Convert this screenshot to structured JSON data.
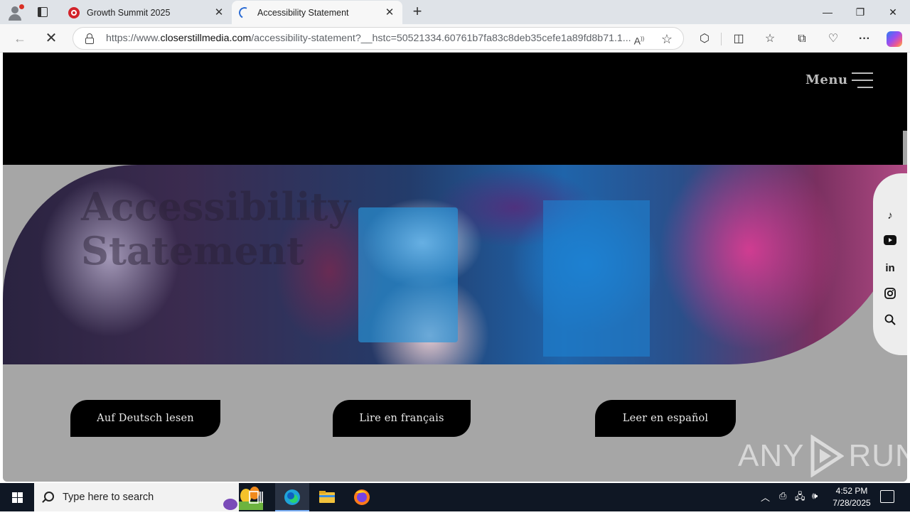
{
  "browser": {
    "tabs": [
      {
        "title": "Growth Summit 2025",
        "favicon": "red-circle-icon",
        "active": false
      },
      {
        "title": "Accessibility Statement",
        "favicon": "loading-spinner-icon",
        "active": true
      }
    ],
    "url_prefix": "https://www.",
    "url_host": "closerstillmedia.com",
    "url_path": "/accessibility-statement?__hstc=50521334.60761b7fa83c8deb35cefe1a89fd8b71.1..."
  },
  "page": {
    "menu_label": "Menu",
    "hero_title_line1": "Accessibility",
    "hero_title_line2": "Statement",
    "social": [
      "tiktok-icon",
      "youtube-icon",
      "linkedin-icon",
      "instagram-icon",
      "search-icon"
    ],
    "language_buttons": [
      "Auf Deutsch lesen",
      "Lire en français",
      "Leer en español"
    ]
  },
  "watermark": {
    "left": "ANY",
    "right": "RUN"
  },
  "taskbar": {
    "search_placeholder": "Type here to search",
    "time": "4:52 PM",
    "date": "7/28/2025"
  }
}
